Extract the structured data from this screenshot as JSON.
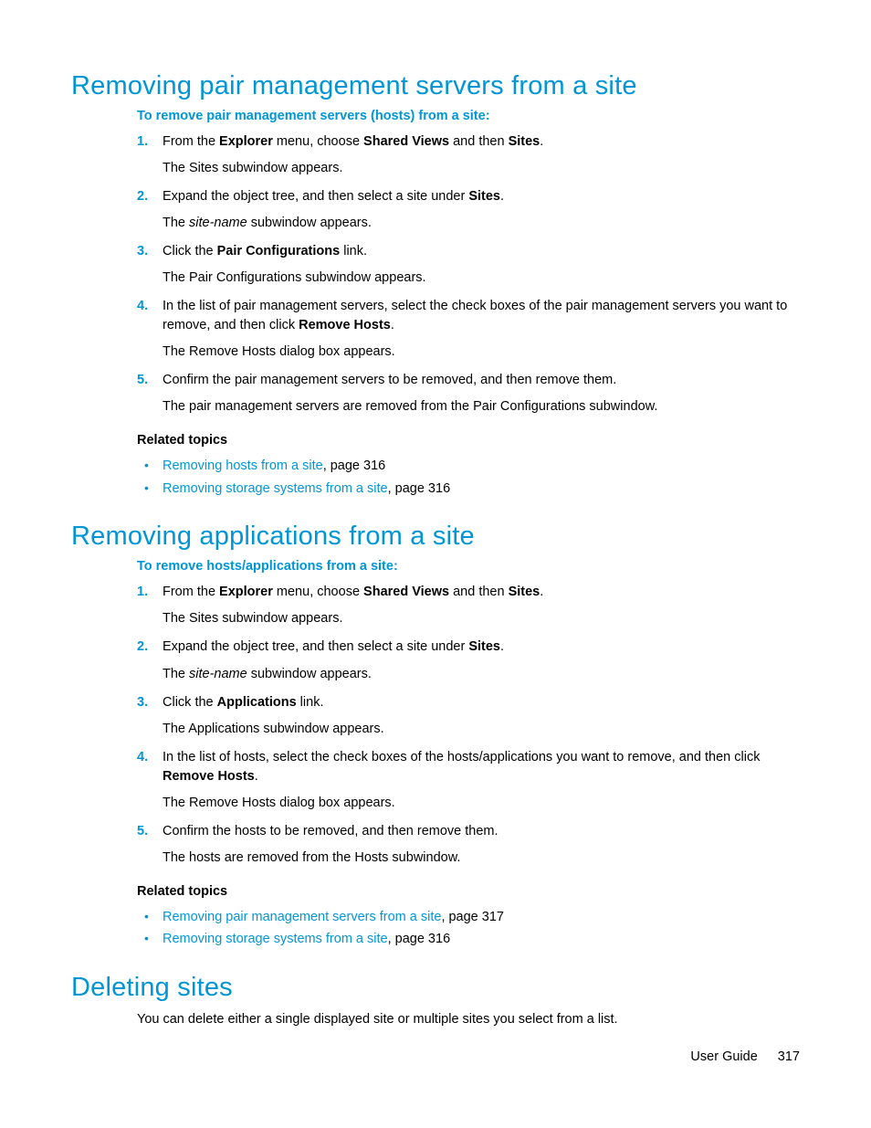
{
  "section1": {
    "heading": "Removing pair management servers from a site",
    "intro": "To remove pair management servers (hosts) from a site:",
    "steps": [
      {
        "main_pre": "From the ",
        "b1": "Explorer",
        "mid1": " menu, choose ",
        "b2": "Shared Views",
        "mid2": " and then ",
        "b3": "Sites",
        "post": ".",
        "result": "The Sites subwindow appears."
      },
      {
        "main_pre": "Expand the object tree, and then select a site under ",
        "b1": "Sites",
        "post": ".",
        "result_pre": "The ",
        "result_italic": "site-name",
        "result_post": " subwindow appears."
      },
      {
        "main_pre": "Click the ",
        "b1": "Pair Configurations",
        "post": " link.",
        "result": "The Pair Configurations subwindow appears."
      },
      {
        "main_pre": "In the list of pair management servers, select the check boxes of the pair management servers you want to remove, and then click ",
        "b1": "Remove Hosts",
        "post": ".",
        "result": "The Remove Hosts dialog box appears."
      },
      {
        "main_pre": "Confirm the pair management servers to be removed, and then remove them.",
        "result": "The pair management servers are removed from the Pair Configurations subwindow."
      }
    ],
    "related_heading": "Related topics",
    "related": [
      {
        "link": "Removing hosts from a site",
        "suffix": ", page 316"
      },
      {
        "link": "Removing storage systems from a site",
        "suffix": ", page 316"
      }
    ]
  },
  "section2": {
    "heading": "Removing applications from a site",
    "intro": "To remove hosts/applications from a site:",
    "steps": [
      {
        "main_pre": "From the ",
        "b1": "Explorer",
        "mid1": " menu, choose ",
        "b2": "Shared Views",
        "mid2": " and then ",
        "b3": "Sites",
        "post": ".",
        "result": "The Sites subwindow appears."
      },
      {
        "main_pre": "Expand the object tree, and then select a site under ",
        "b1": "Sites",
        "post": ".",
        "result_pre": "The ",
        "result_italic": "site-name",
        "result_post": " subwindow appears."
      },
      {
        "main_pre": "Click the ",
        "b1": "Applications",
        "post": " link.",
        "result": "The Applications subwindow appears."
      },
      {
        "main_pre": "In the list of hosts, select the check boxes of the hosts/applications you want to remove, and then click ",
        "b1": "Remove Hosts",
        "post": ".",
        "result": "The Remove Hosts dialog box appears."
      },
      {
        "main_pre": "Confirm the hosts to be removed, and then remove them.",
        "result": "The hosts are removed from the Hosts subwindow."
      }
    ],
    "related_heading": "Related topics",
    "related": [
      {
        "link": "Removing pair management servers from a site",
        "suffix": ", page 317"
      },
      {
        "link": "Removing storage systems from a site",
        "suffix": ", page 316"
      }
    ]
  },
  "section3": {
    "heading": "Deleting sites",
    "body": "You can delete either a single displayed site or multiple sites you select from a list."
  },
  "footer": {
    "label": "User Guide",
    "page": "317"
  }
}
